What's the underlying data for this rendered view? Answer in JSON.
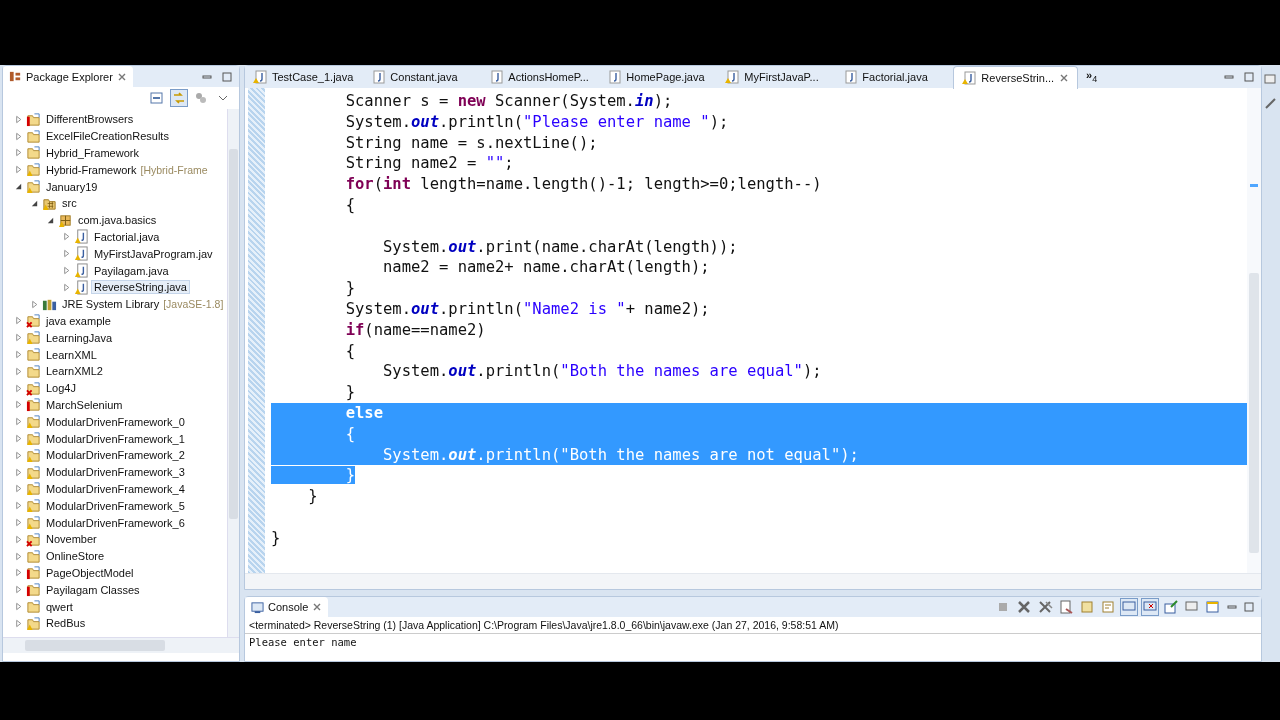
{
  "explorer": {
    "title": "Package Explorer",
    "items": [
      {
        "name": "DifferentBrowsers",
        "kind": "project",
        "warning": false,
        "error": true,
        "closed": false,
        "expanded": false,
        "selected": false
      },
      {
        "name": "ExcelFileCreationResults",
        "kind": "project",
        "warning": false,
        "error": false,
        "closed": false,
        "expanded": false,
        "selected": false
      },
      {
        "name": "Hybrid_Framework",
        "kind": "project",
        "warning": false,
        "error": false,
        "closed": false,
        "expanded": false,
        "selected": false
      },
      {
        "name": "Hybrid-Framework",
        "decoration": "[Hybrid-Frame",
        "kind": "project",
        "warning": true,
        "error": false,
        "closed": false,
        "expanded": false,
        "selected": false
      },
      {
        "name": "January19",
        "kind": "project",
        "warning": true,
        "error": false,
        "closed": false,
        "expanded": true,
        "selected": false,
        "children": [
          {
            "name": "src",
            "kind": "src",
            "warning": true,
            "error": false,
            "closed": false,
            "expanded": true,
            "selected": false,
            "children": [
              {
                "name": "com.java.basics",
                "kind": "package",
                "warning": true,
                "error": false,
                "closed": false,
                "expanded": true,
                "selected": false,
                "children": [
                  {
                    "name": "Factorial.java",
                    "kind": "java",
                    "warning": true,
                    "error": false,
                    "closed": false,
                    "expanded": false,
                    "selected": false
                  },
                  {
                    "name": "MyFirstJavaProgram.jav",
                    "kind": "java",
                    "warning": true,
                    "error": false,
                    "closed": false,
                    "expanded": false,
                    "selected": false
                  },
                  {
                    "name": "Payilagam.java",
                    "kind": "java",
                    "warning": true,
                    "error": false,
                    "closed": false,
                    "expanded": false,
                    "selected": false
                  },
                  {
                    "name": "ReverseString.java",
                    "kind": "java",
                    "warning": true,
                    "error": false,
                    "closed": false,
                    "expanded": false,
                    "selected": true
                  }
                ]
              }
            ]
          },
          {
            "name": "JRE System Library",
            "decoration": "[JavaSE-1.8]",
            "kind": "library",
            "warning": false,
            "error": false,
            "closed": false,
            "expanded": false,
            "selected": false
          }
        ]
      },
      {
        "name": "java example",
        "kind": "project",
        "warning": false,
        "error": false,
        "closed": true,
        "expanded": false,
        "selected": false
      },
      {
        "name": "LearningJava",
        "kind": "project",
        "warning": true,
        "error": false,
        "closed": false,
        "expanded": false,
        "selected": false
      },
      {
        "name": "LearnXML",
        "kind": "project",
        "warning": false,
        "error": false,
        "closed": false,
        "expanded": false,
        "selected": false
      },
      {
        "name": "LearnXML2",
        "kind": "project",
        "warning": false,
        "error": false,
        "closed": false,
        "expanded": false,
        "selected": false
      },
      {
        "name": "Log4J",
        "kind": "project",
        "warning": false,
        "error": false,
        "closed": true,
        "expanded": false,
        "selected": false
      },
      {
        "name": "MarchSelenium",
        "kind": "project",
        "warning": false,
        "error": true,
        "closed": false,
        "expanded": false,
        "selected": false
      },
      {
        "name": "ModularDrivenFramework_0",
        "kind": "project",
        "warning": true,
        "error": false,
        "closed": false,
        "expanded": false,
        "selected": false
      },
      {
        "name": "ModularDrivenFramework_1",
        "kind": "project",
        "warning": true,
        "error": false,
        "closed": false,
        "expanded": false,
        "selected": false
      },
      {
        "name": "ModularDrivenFramework_2",
        "kind": "project",
        "warning": true,
        "error": false,
        "closed": false,
        "expanded": false,
        "selected": false
      },
      {
        "name": "ModularDrivenFramework_3",
        "kind": "project",
        "warning": true,
        "error": false,
        "closed": false,
        "expanded": false,
        "selected": false
      },
      {
        "name": "ModularDrivenFramework_4",
        "kind": "project",
        "warning": true,
        "error": false,
        "closed": false,
        "expanded": false,
        "selected": false
      },
      {
        "name": "ModularDrivenFramework_5",
        "kind": "project",
        "warning": true,
        "error": false,
        "closed": false,
        "expanded": false,
        "selected": false
      },
      {
        "name": "ModularDrivenFramework_6",
        "kind": "project",
        "warning": true,
        "error": false,
        "closed": false,
        "expanded": false,
        "selected": false
      },
      {
        "name": "November",
        "kind": "project",
        "warning": false,
        "error": false,
        "closed": true,
        "expanded": false,
        "selected": false
      },
      {
        "name": "OnlineStore",
        "kind": "project",
        "warning": false,
        "error": false,
        "closed": false,
        "expanded": false,
        "selected": false
      },
      {
        "name": "PageObjectModel",
        "kind": "project",
        "warning": false,
        "error": true,
        "closed": false,
        "expanded": false,
        "selected": false
      },
      {
        "name": "Payilagam Classes",
        "kind": "project",
        "warning": false,
        "error": true,
        "closed": false,
        "expanded": false,
        "selected": false
      },
      {
        "name": "qwert",
        "kind": "project",
        "warning": false,
        "error": false,
        "closed": false,
        "expanded": false,
        "selected": false
      },
      {
        "name": "RedBus",
        "kind": "project",
        "warning": true,
        "error": false,
        "closed": false,
        "expanded": false,
        "selected": false
      }
    ]
  },
  "editor": {
    "tabs": [
      {
        "label": "TestCase_1.java",
        "warning": true,
        "selected": false
      },
      {
        "label": "Constant.java",
        "warning": false,
        "selected": false
      },
      {
        "label": "ActionsHomeP...",
        "warning": false,
        "selected": false
      },
      {
        "label": "HomePage.java",
        "warning": false,
        "selected": false
      },
      {
        "label": "MyFirstJavaP...",
        "warning": true,
        "selected": false
      },
      {
        "label": "Factorial.java",
        "warning": false,
        "selected": false
      },
      {
        "label": "ReverseStrin...",
        "warning": true,
        "selected": true
      }
    ],
    "overflow": {
      "glyph": "»",
      "count": "4"
    },
    "lines": [
      {
        "selected": false,
        "tokens": [
          {
            "t": "        Scanner s = "
          },
          {
            "t": "new",
            "kind": "kw"
          },
          {
            "t": " Scanner(System."
          },
          {
            "t": "in",
            "kind": "field"
          },
          {
            "t": ");"
          }
        ]
      },
      {
        "selected": false,
        "tokens": [
          {
            "t": "        System."
          },
          {
            "t": "out",
            "kind": "field"
          },
          {
            "t": ".println("
          },
          {
            "t": "\"Please enter name \"",
            "kind": "str"
          },
          {
            "t": ");"
          }
        ]
      },
      {
        "selected": false,
        "tokens": [
          {
            "t": "        String name = s.nextLine();"
          }
        ]
      },
      {
        "selected": false,
        "tokens": [
          {
            "t": "        String name2 = "
          },
          {
            "t": "\"\"",
            "kind": "str"
          },
          {
            "t": ";"
          }
        ]
      },
      {
        "selected": false,
        "tokens": [
          {
            "t": "        for",
            "kind": "kw"
          },
          {
            "t": "("
          },
          {
            "t": "int",
            "kind": "kw"
          },
          {
            "t": " length=name.length()-1; length>=0;length--)"
          }
        ]
      },
      {
        "selected": false,
        "tokens": [
          {
            "t": "        {"
          }
        ]
      },
      {
        "selected": false
      },
      {
        "selected": false,
        "tokens": [
          {
            "t": "            System."
          },
          {
            "t": "out",
            "kind": "field"
          },
          {
            "t": ".print(name.charAt(length));"
          }
        ]
      },
      {
        "selected": false,
        "tokens": [
          {
            "t": "            name2 = name2+ name.charAt(length);"
          }
        ]
      },
      {
        "selected": false,
        "tokens": [
          {
            "t": "        }"
          }
        ]
      },
      {
        "selected": false,
        "tokens": [
          {
            "t": "        System."
          },
          {
            "t": "out",
            "kind": "field"
          },
          {
            "t": ".println("
          },
          {
            "t": "\"Name2 is \"",
            "kind": "str"
          },
          {
            "t": "+ name2);"
          }
        ]
      },
      {
        "selected": false,
        "tokens": [
          {
            "t": "        if",
            "kind": "kw"
          },
          {
            "t": "(name==name2)"
          }
        ]
      },
      {
        "selected": false,
        "tokens": [
          {
            "t": "        {"
          }
        ]
      },
      {
        "selected": false,
        "tokens": [
          {
            "t": "            System."
          },
          {
            "t": "out",
            "kind": "field"
          },
          {
            "t": ".println("
          },
          {
            "t": "\"Both the names are equal\"",
            "kind": "str"
          },
          {
            "t": ");"
          }
        ]
      },
      {
        "selected": false,
        "tokens": [
          {
            "t": "        }"
          }
        ]
      },
      {
        "selected": true,
        "tokens": [
          {
            "t": "        else",
            "kind": "kw"
          }
        ]
      },
      {
        "selected": true,
        "tokens": [
          {
            "t": "        {"
          }
        ]
      },
      {
        "selected": true,
        "tokens": [
          {
            "t": "            System."
          },
          {
            "t": "out",
            "kind": "field"
          },
          {
            "t": ".println("
          },
          {
            "t": "\"Both the names are not equal\"",
            "kind": "str"
          },
          {
            "t": ");"
          }
        ]
      },
      {
        "selected": true,
        "tokens": [
          {
            "t": "        }"
          }
        ]
      },
      {
        "selected": false,
        "tokens": [
          {
            "t": "    }"
          }
        ]
      },
      {
        "selected": false
      },
      {
        "selected": false,
        "tokens": [
          {
            "t": "}"
          }
        ]
      }
    ]
  },
  "console": {
    "title": "Console",
    "status": "<terminated> ReverseString (1) [Java Application] C:\\Program Files\\Java\\jre1.8.0_66\\bin\\javaw.exe (Jan 27, 2016, 9:58:51 AM)",
    "output": "Please enter name"
  }
}
